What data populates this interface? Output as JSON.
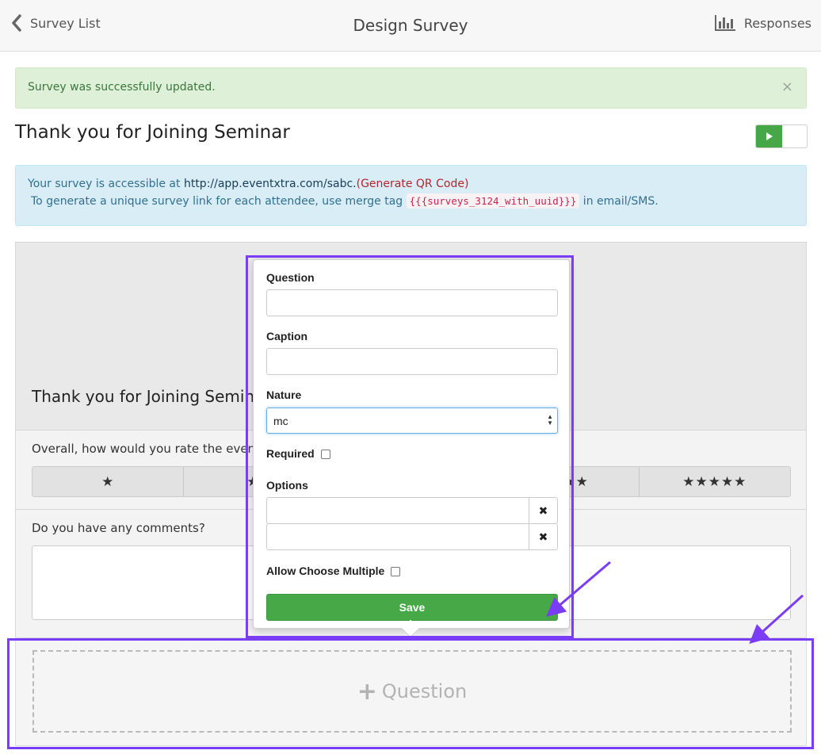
{
  "header": {
    "back_label": "Survey List",
    "title": "Design Survey",
    "responses_label": "Responses"
  },
  "success_alert": {
    "message": "Survey was successfully updated.",
    "close_symbol": "×"
  },
  "survey": {
    "title": "Thank you for Joining Seminar",
    "toggle_state": "on"
  },
  "info_alert": {
    "line1_prefix": "Your survey is accessible at ",
    "url": "http://app.eventxtra.com/sabc.",
    "qr_link": "(Generate QR Code)",
    "line2_prefix": "To generate a unique survey link for each attendee, use merge tag ",
    "merge_tag": "{{{surveys_3124_with_uuid}}}",
    "line2_suffix": " in email/SMS."
  },
  "preview": {
    "title": "Thank you for Joining Semina",
    "question1": "Overall, how would you rate the even",
    "ratings": [
      "★",
      "★★",
      "★★★",
      "★★★★",
      "★★★★★"
    ],
    "question2": "Do you have any comments?"
  },
  "editor": {
    "question_label": "Question",
    "question_value": "",
    "caption_label": "Caption",
    "caption_value": "",
    "nature_label": "Nature",
    "nature_value": "mc",
    "required_label": "Required",
    "options_label": "Options",
    "options": [
      "",
      ""
    ],
    "delete_symbol": "✖",
    "allow_multiple_label": "Allow Choose Multiple",
    "save_label": "Save"
  },
  "add_question": {
    "plus": "+",
    "label": "Question"
  },
  "colors": {
    "accent_green": "#46a847",
    "annotation_purple": "#7b3cf5"
  }
}
